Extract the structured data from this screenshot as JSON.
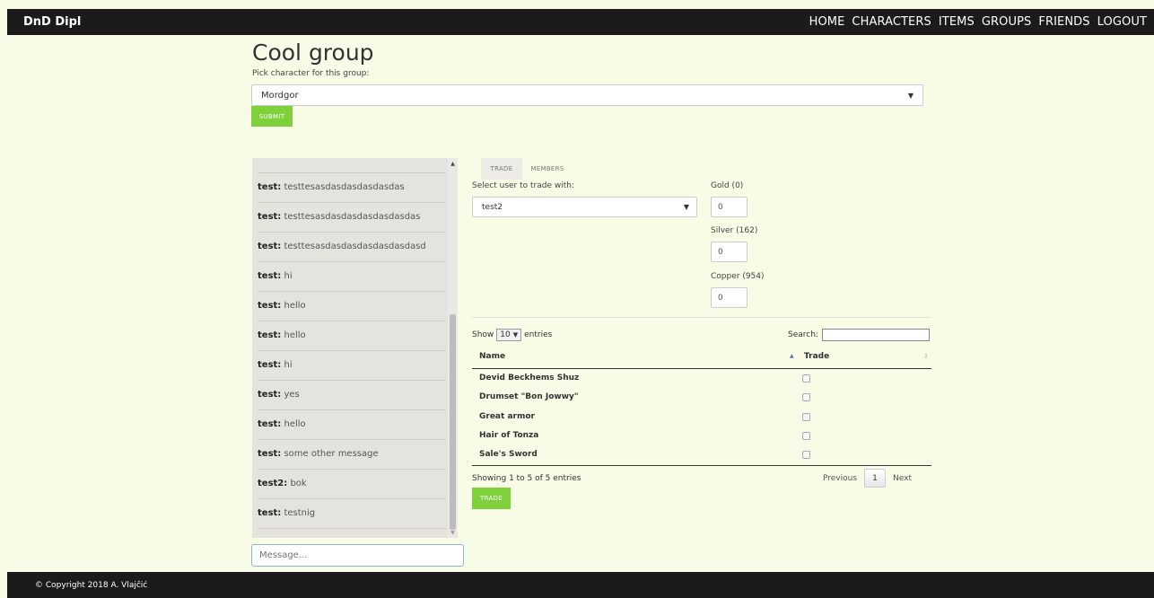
{
  "navbar": {
    "brand": "DnD Dipl",
    "links": [
      "HOME",
      "CHARACTERS",
      "ITEMS",
      "GROUPS",
      "FRIENDS",
      "LOGOUT"
    ]
  },
  "group": {
    "title": "Cool group",
    "pick_label": "Pick character for this group:",
    "selected_character": "Mordgor",
    "submit_label": "SUBMIT"
  },
  "chat": {
    "messages": [
      {
        "user": "test:",
        "text": " testtesasdasdasdasdasdas"
      },
      {
        "user": "test:",
        "text": " testtesasdasdasdasdasdasdas"
      },
      {
        "user": "test:",
        "text": " testtesasdasdasdasdasdasdasd"
      },
      {
        "user": "test:",
        "text": " hi"
      },
      {
        "user": "test:",
        "text": " hello"
      },
      {
        "user": "test:",
        "text": " hello"
      },
      {
        "user": "test:",
        "text": " hi"
      },
      {
        "user": "test:",
        "text": " yes"
      },
      {
        "user": "test:",
        "text": " hello"
      },
      {
        "user": "test:",
        "text": " some other message"
      },
      {
        "user": "test2:",
        "text": " bok"
      },
      {
        "user": "test:",
        "text": " testnig"
      }
    ],
    "input_placeholder": "Message..."
  },
  "tabs": {
    "trade": "TRADE",
    "members": "MEMBERS"
  },
  "trade": {
    "select_user_label": "Select user to trade with:",
    "selected_user": "test2",
    "gold_label": "Gold (0)",
    "gold_value": "0",
    "silver_label": "Silver (162)",
    "silver_value": "0",
    "copper_label": "Copper (954)",
    "copper_value": "0",
    "trade_button": "TRADE"
  },
  "table": {
    "show_label": "Show",
    "entries_value": "10",
    "entries_label": "entries",
    "search_label": "Search:",
    "col_name": "Name",
    "col_trade": "Trade",
    "rows": [
      "Devid Beckhems Shuz",
      "Drumset \"Bon Jowwy\"",
      "Great armor",
      "Hair of Tonza",
      "Sale's Sword"
    ],
    "showing_text": "Showing 1 to 5 of 5 entries",
    "previous": "Previous",
    "page": "1",
    "next": "Next"
  },
  "footer": {
    "copyright": "© Copyright 2018 A. Vlajčić"
  }
}
